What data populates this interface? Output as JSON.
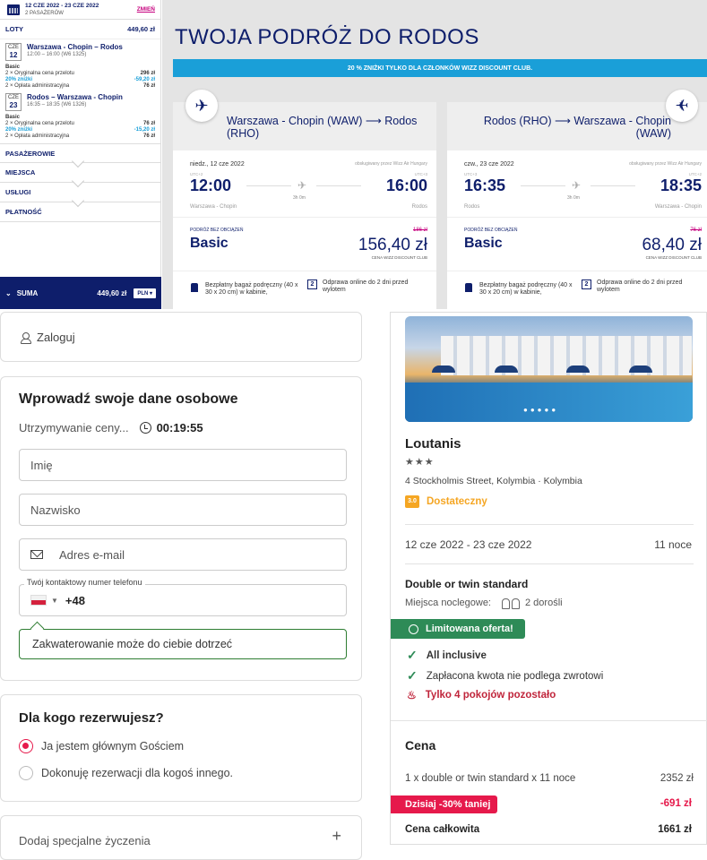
{
  "flights": {
    "sidebar": {
      "dates": "12 CZE 2022 - 23 CZE 2022",
      "passengers": "2 PASAŻERÓW",
      "change_label": "ZMIEŃ",
      "flights_label": "LOTY",
      "flights_total": "449,60 zł",
      "outbound": {
        "weekday": "CZE",
        "day": "12",
        "route": "Warszawa - Chopin – Rodos",
        "times": "12:00 – 16:00 (W6 1325)",
        "fare": "Basic",
        "fare_line": "2 × Oryginalna cena przelotu",
        "fare_val": "296 zł",
        "disc_line": "20% zniżki",
        "disc_val": "-59,20 zł",
        "fee_line": "2 × Opłata administracyjna",
        "fee_val": "76 zł"
      },
      "inbound": {
        "weekday": "CZE",
        "day": "23",
        "route": "Rodos – Warszawa - Chopin",
        "times": "16:35 – 18:35 (W6 1326)",
        "fare": "Basic",
        "fare_line": "2 × Oryginalna cena przelotu",
        "fare_val": "76 zł",
        "disc_line": "20% zniżki",
        "disc_val": "-15,20 zł",
        "fee_line": "2 × Opłata administracyjna",
        "fee_val": "76 zł"
      },
      "sections": [
        "PASAŻEROWIE",
        "MIEJSCA",
        "USŁUGI",
        "PŁATNOŚĆ"
      ],
      "sum_label": "SUMA",
      "sum_value": "449,60 zł",
      "currency": "PLN"
    },
    "title": "TWOJA PODRÓŻ DO RODOS",
    "promo": "20 % ZNIŻKI TYLKO DLA CZŁONKÓW WIZZ DISCOUNT CLUB.",
    "cards": [
      {
        "route": "Warszawa - Chopin (WAW) ⟶ Rodos (RHO)",
        "date": "niedz., 12 cze 2022",
        "operated": "obsługiwany przez Wizz Air Hungary",
        "utc_dep": "UTC+2",
        "utc_arr": "UTC+3",
        "dep": "12:00",
        "arr": "16:00",
        "duration": "3h 0m",
        "from": "Warszawa - Chopin",
        "to": "Rodos",
        "fare_label": "PODRÓŻ BEZ OBCIĄŻEŃ",
        "fare": "Basic",
        "old_price": "186 zł",
        "price": "156,40 zł",
        "club": "CENA WIZZ DISCOUNT CLUB",
        "bag": "Bezpłatny bagaż podręczny (40 x 30 x 20 cm) w kabinie,",
        "checkin_day": "2",
        "checkin": "Odprawa online do 2 dni przed wylotem"
      },
      {
        "route": "Rodos (RHO) ⟶ Warszawa - Chopin (WAW)",
        "date": "czw., 23 cze 2022",
        "operated": "obsługiwany przez Wizz Air Hungary",
        "utc_dep": "UTC+3",
        "utc_arr": "UTC+2",
        "dep": "16:35",
        "arr": "18:35",
        "duration": "3h 0m",
        "from": "Rodos",
        "to": "Warszawa - Chopin",
        "fare_label": "PODRÓŻ BEZ OBCIĄŻEŃ",
        "fare": "Basic",
        "old_price": "76 zł",
        "price": "68,40 zł",
        "club": "CENA WIZZ DISCOUNT CLUB",
        "bag": "Bezpłatny bagaż podręczny (40 x 30 x 20 cm) w kabinie,",
        "checkin_day": "2",
        "checkin": "Odprawa online do 2 dni przed wylotem"
      }
    ]
  },
  "booking": {
    "login": "Zaloguj",
    "form_title": "Wprowadź swoje dane osobowe",
    "hold_label": "Utrzymywanie ceny...",
    "timer": "00:19:55",
    "first_name_placeholder": "Imię",
    "last_name_placeholder": "Nazwisko",
    "email_placeholder": "Adres e-mail",
    "phone_label": "Twój kontaktowy numer telefonu",
    "dial_code": "+48",
    "tip": "Zakwaterowanie może do ciebie dotrzeć",
    "who_title": "Dla kogo rezerwujesz?",
    "who_options": [
      "Ja jestem głównym Gościem",
      "Dokonuję rezerwacji dla kogoś innego."
    ],
    "who_selected": 0,
    "special_requests": "Dodaj specjalne życzenia",
    "special_plus": "+"
  },
  "hotel": {
    "name": "Loutanis",
    "stars": "★★★",
    "address": "4 Stockholmis Street, Kolymbia · Kolymbia",
    "rating_score": "3.0",
    "rating_label": "Dostateczny",
    "stay_dates": "12 cze 2022 - 23 cze 2022",
    "nights": "11 noce",
    "room": "Double or twin standard",
    "beds_label": "Miejsca noclegowe:",
    "guests": "2 dorośli",
    "offer": "Limitowana oferta!",
    "features": [
      "All inclusive",
      "Zapłacona kwota nie podlega zwrotowi"
    ],
    "scarcity": "Tylko 4 pokojów pozostało",
    "price_title": "Cena",
    "line_item": "1 x double or twin standard x 11 noce",
    "line_value": "2352 zł",
    "today_label": "Dzisiaj -30% taniej",
    "discount_value": "-691 zł",
    "total_label": "Cena całkowita",
    "total_value": "1661 zł"
  },
  "colors": {
    "wizz_navy": "#0e1e6b",
    "wizz_pink": "#c6007e",
    "wizz_blue": "#1a9fd8",
    "accent_red": "#e6194b",
    "green": "#2e8b57",
    "rating_orange": "#f5a623"
  }
}
